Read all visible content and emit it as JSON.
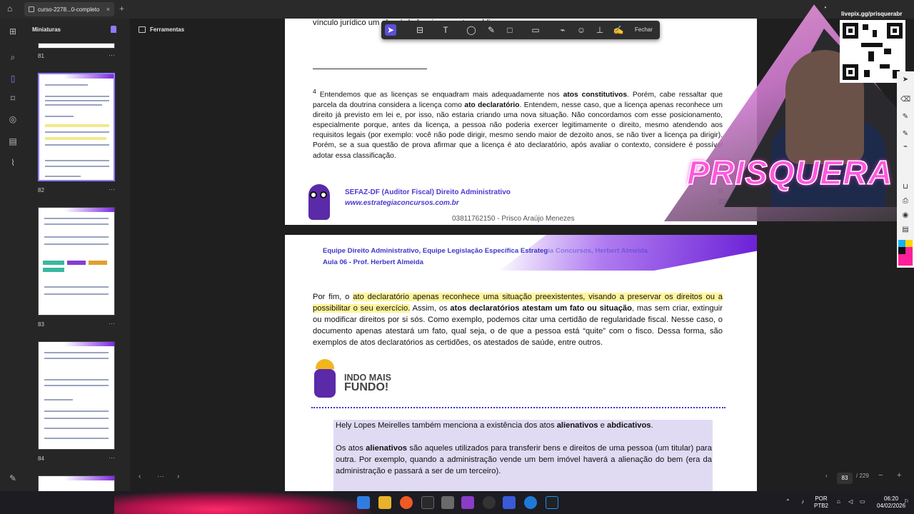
{
  "tab": {
    "title": "curso-2278...0-completo",
    "close": "×"
  },
  "thumbnails": {
    "header": "Miniaturas",
    "pages": [
      "81",
      "82",
      "83",
      "84"
    ]
  },
  "tools_pane": {
    "label": "Ferramentas"
  },
  "toolbar": {
    "close_label": "Fechar"
  },
  "page1": {
    "top_text": "vínculo jurídico                                               um alvará de funcionamento ou                                                              blicos.",
    "footnote_num": "4",
    "footnote_a": " Entendemos que as licenças se enquadram mais adequadamente nos ",
    "footnote_b": "atos constitutivos",
    "footnote_c": ". Porém, cabe ressaltar que parcela da doutrina considera a licença como ",
    "footnote_d": "ato declaratório",
    "footnote_e": ". Entendem, nesse caso, que a licença apenas reconhece um direito já previsto em lei e, por isso, não estaria criando uma nova situação. Não concordamos com esse posicionamento, especialmente porque, antes da licença, a pessoa não poderia exercer legitimamente o direito, mesmo atendendo aos requisitos legais (por exemplo: você não pode dirigir, mesmo sendo maior de dezoito anos, se não tiver a licença pa dirigir). Porém, se a sua questão de prova afirmar que a licença é ato declaratório, após avaliar o contexto, considere é possível adotar essa classificação.",
    "footer_title": "SEFAZ-DF (Auditor Fiscal) Direito Administrativo",
    "footer_url": "www.estrategiaconcursos.com.br",
    "footer_id": "03811762150 - Prisco Araújo Menezes",
    "page_number": "8",
    "page_total": "229"
  },
  "page2": {
    "header_line1": "Equipe Direito Administrativo, Equipe Legislação Específica Estrateg",
    "header_line1_faded": "ia Concursos, Herbert Almeida",
    "header_line2": "Aula 06 - Prof. Herbert Almeida",
    "para_a": "Por fim, o ",
    "para_hl": "ato declaratório apenas reconhece uma situação preexistentes, visando a preservar os direitos ou a possibilitar o seu exercício.",
    "para_b": " Assim, os ",
    "para_bold": "atos declaratórios atestam um fato ou situação",
    "para_c": ", mas sem criar, extinguir ou modificar direitos por si sós. Como exemplo, podemos citar uma certidão de regularidade fiscal. Nesse caso, o documento apenas atestará um fato, qual seja, o de que a pessoa está “quite” com o fisco. Dessa forma, são exemplos de atos declaratórios as certidões, os atestados de saúde, entre outros.",
    "indo_line1": "INDO MAIS",
    "indo_line2": "FUNDO!",
    "box_p1_a": "Hely Lopes Meirelles também menciona a existência dos atos ",
    "box_p1_b": "alienativos",
    "box_p1_c": " e ",
    "box_p1_d": "abdicativos",
    "box_p1_e": ".",
    "box_p2_a": "Os atos ",
    "box_p2_b": "alienativos",
    "box_p2_c": " são aqueles utilizados para transferir bens e direitos de uma pessoa (um titular) para outra. Por exemplo, quando a administração vende um bem imóvel haverá a alienação do bem (era da administração e passará a ser de um terceiro)."
  },
  "overlay": {
    "qr_label": "livepix.gg/prisquerabr",
    "brand": "PRISQUERA"
  },
  "page_control": {
    "current": "83",
    "total": "/ 229"
  },
  "taskbar": {
    "lang": "POR",
    "layout": "PTB2",
    "time": "06:20",
    "date": "04/02/2026"
  },
  "colors": {
    "accent": "#8a7dff",
    "brand_purple": "#6a1fd6",
    "highlight": "#fff59a",
    "stream_pink": "#ff58e0"
  }
}
